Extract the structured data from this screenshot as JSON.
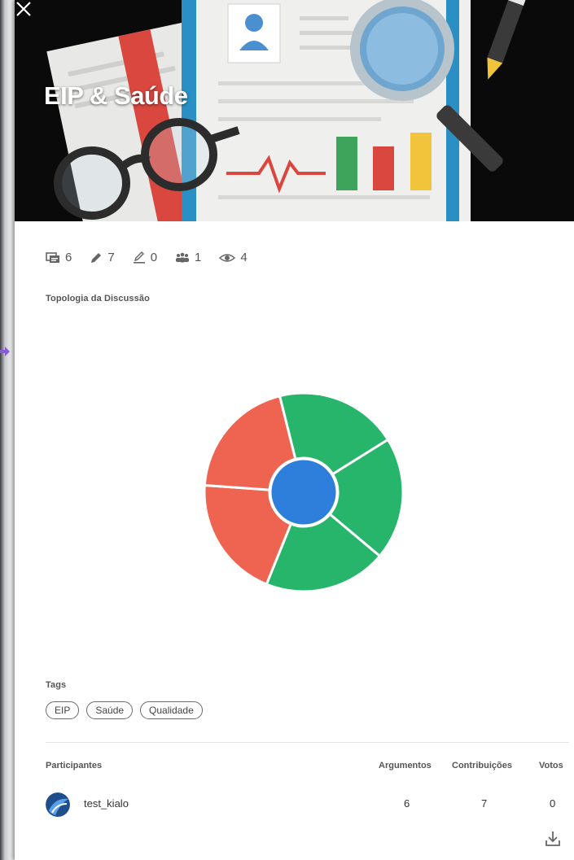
{
  "discussion": {
    "title": "EIP & Saúde"
  },
  "stats": {
    "arguments": "6",
    "contributions": "7",
    "edits": "0",
    "participants": "1",
    "views": "4"
  },
  "topology": {
    "label": "Topologia da Discussão"
  },
  "chart_data": {
    "type": "pie",
    "center": {
      "color": "#2e7fdb"
    },
    "segments": [
      {
        "color": "#27b56b",
        "value": 1
      },
      {
        "color": "#27b56b",
        "value": 1
      },
      {
        "color": "#27b56b",
        "value": 1
      },
      {
        "color": "#ef6450",
        "value": 1
      },
      {
        "color": "#ef6450",
        "value": 1
      }
    ]
  },
  "tags": {
    "label": "Tags",
    "items": [
      "EIP",
      "Saúde",
      "Qualidade"
    ]
  },
  "participants": {
    "label": "Participantes",
    "columns": [
      "Argumentos",
      "Contribuições",
      "Votos"
    ],
    "rows": [
      {
        "name": "test_kialo",
        "arguments": "6",
        "contributions": "7",
        "votes": "0"
      }
    ]
  },
  "colors": {
    "pro": "#27b56b",
    "con": "#ef6450",
    "thesis": "#2e7fdb"
  }
}
